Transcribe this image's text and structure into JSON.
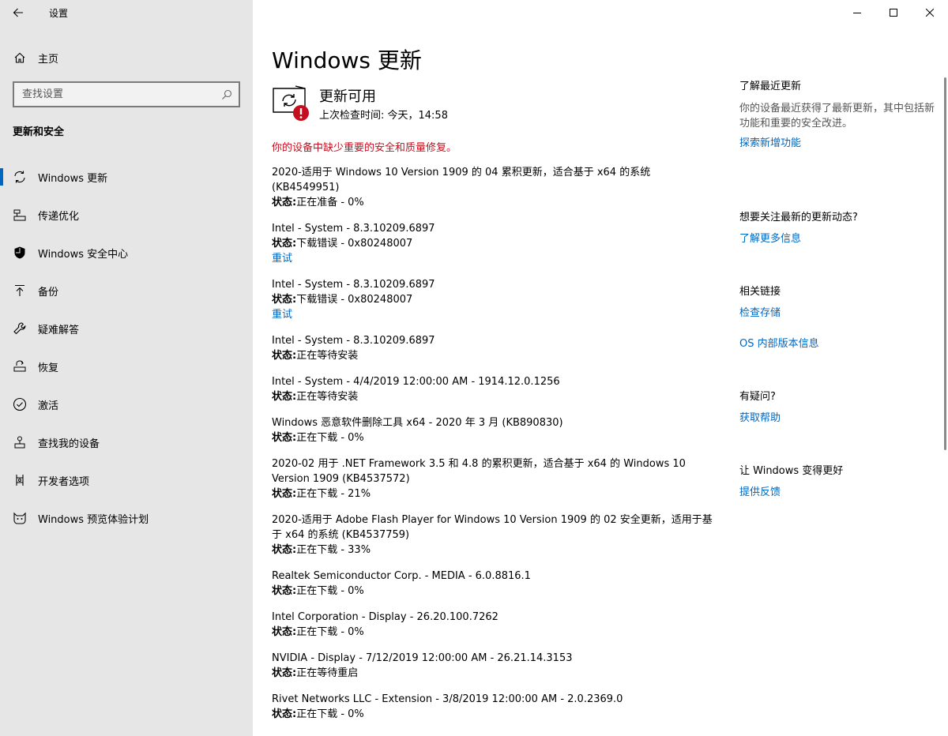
{
  "window": {
    "app_title": "设置"
  },
  "sidebar": {
    "home_label": "主页",
    "search_placeholder": "查找设置",
    "section_title": "更新和安全",
    "items": [
      {
        "label": "Windows 更新",
        "icon": "sync-icon",
        "active": true
      },
      {
        "label": "传递优化",
        "icon": "delivery-optimization-icon"
      },
      {
        "label": "Windows 安全中心",
        "icon": "shield-icon"
      },
      {
        "label": "备份",
        "icon": "backup-arrow-icon"
      },
      {
        "label": "疑难解答",
        "icon": "wrench-icon"
      },
      {
        "label": "恢复",
        "icon": "recovery-icon"
      },
      {
        "label": "激活",
        "icon": "check-circle-icon"
      },
      {
        "label": "查找我的设备",
        "icon": "find-device-icon"
      },
      {
        "label": "开发者选项",
        "icon": "developer-icon"
      },
      {
        "label": "Windows 预览体验计划",
        "icon": "insider-cat-icon"
      }
    ]
  },
  "main": {
    "title": "Windows 更新",
    "status_heading": "更新可用",
    "status_sub": "上次检查时间: 今天，14:58",
    "warning": "你的设备中缺少重要的安全和质量修复。",
    "state_prefix": "状态:",
    "updates": [
      {
        "name": "2020-适用于 Windows 10 Version 1909 的 04 累积更新，适合基于 x64 的系统 (KB4549951)",
        "state": "正在准备 - 0%",
        "link": ""
      },
      {
        "name": "Intel - System - 8.3.10209.6897",
        "state": "下载错误 - 0x80248007",
        "link": "重试"
      },
      {
        "name": "Intel - System - 8.3.10209.6897",
        "state": "下载错误 - 0x80248007",
        "link": "重试"
      },
      {
        "name": "Intel - System - 8.3.10209.6897",
        "state": "正在等待安装",
        "link": ""
      },
      {
        "name": "Intel - System - 4/4/2019 12:00:00 AM - 1914.12.0.1256",
        "state": "正在等待安装",
        "link": ""
      },
      {
        "name": "Windows 恶意软件删除工具 x64 - 2020 年 3 月 (KB890830)",
        "state": "正在下载 - 0%",
        "link": ""
      },
      {
        "name": "2020-02 用于 .NET Framework 3.5 和 4.8 的累积更新，适合基于 x64 的 Windows 10 Version 1909 (KB4537572)",
        "state": "正在下载 - 21%",
        "link": ""
      },
      {
        "name": "2020-适用于 Adobe Flash Player for Windows 10 Version 1909 的 02 安全更新，适用于基于 x64 的系统 (KB4537759)",
        "state": "正在下载 - 33%",
        "link": ""
      },
      {
        "name": "Realtek Semiconductor Corp. - MEDIA - 6.0.8816.1",
        "state": "正在下载 - 0%",
        "link": ""
      },
      {
        "name": "Intel Corporation - Display - 26.20.100.7262",
        "state": "正在下载 - 0%",
        "link": ""
      },
      {
        "name": "NVIDIA - Display - 7/12/2019 12:00:00 AM - 26.21.14.3153",
        "state": "正在等待重启",
        "link": ""
      },
      {
        "name": "Rivet Networks LLC - Extension - 3/8/2019 12:00:00 AM - 2.0.2369.0",
        "state": "正在下载 - 0%",
        "link": ""
      }
    ]
  },
  "right": {
    "recent_heading": "了解最近更新",
    "recent_text": "你的设备最近获得了最新更新，其中包括新功能和重要的安全改进。",
    "recent_link": "探索新增功能",
    "follow_heading": "想要关注最新的更新动态?",
    "follow_link": "了解更多信息",
    "related_heading": "相关链接",
    "related_link1": "检查存储",
    "related_link2": "OS 内部版本信息",
    "question_heading": "有疑问?",
    "question_link": "获取帮助",
    "better_heading": "让 Windows 变得更好",
    "better_link": "提供反馈"
  },
  "colors": {
    "accent": "#0067c0",
    "warning": "#c50f1f",
    "sidebar_bg": "#e6e6e6"
  }
}
